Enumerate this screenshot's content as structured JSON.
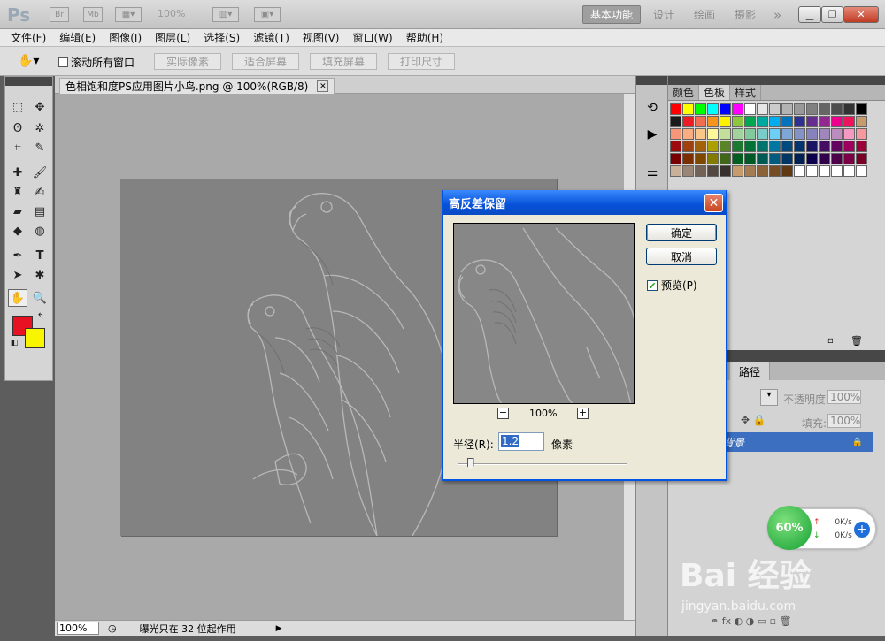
{
  "app": {
    "logo": "Ps",
    "zoom_display": "100%",
    "workspaces": [
      "基本功能",
      "设计",
      "绘画",
      "摄影"
    ],
    "more": "»",
    "bridge_label": "Br",
    "mini_label": "Mb"
  },
  "menu": [
    "文件(F)",
    "编辑(E)",
    "图像(I)",
    "图层(L)",
    "选择(S)",
    "滤镜(T)",
    "视图(V)",
    "窗口(W)",
    "帮助(H)"
  ],
  "options": {
    "scroll_all": "滚动所有窗口",
    "buttons": [
      "实际像素",
      "适合屏幕",
      "填充屏幕",
      "打印尺寸"
    ]
  },
  "document": {
    "tab_title": "色相饱和度PS应用图片小鸟.png @ 100%(RGB/8)",
    "zoom": "100%",
    "status": "曝光只在 32 位起作用"
  },
  "panels": {
    "swatch_tabs": [
      "颜色",
      "色板",
      "样式"
    ],
    "layer_tabs": [
      "路径"
    ],
    "opacity_label": "不透明度:",
    "opacity_value": "100%",
    "fill_label": "填充:",
    "fill_value": "100%",
    "layer_name": "背景",
    "swatch_colors": [
      "#ff0000",
      "#ffff00",
      "#00ff00",
      "#00ffff",
      "#0000ff",
      "#ff00ff",
      "#ffffff",
      "#e6e6e6",
      "#cccccc",
      "#b3b3b3",
      "#999999",
      "#808080",
      "#666666",
      "#4d4d4d",
      "#333333",
      "#000000",
      "#1a1a1a",
      "#ed1c24",
      "#f26c4f",
      "#f7941d",
      "#fff200",
      "#8dc63f",
      "#00a651",
      "#00a99d",
      "#00aeef",
      "#0072bc",
      "#2e3192",
      "#662d91",
      "#92278f",
      "#ec008c",
      "#ed145b",
      "#c69c6d",
      "#f69679",
      "#f9ad81",
      "#fdc689",
      "#fff799",
      "#c4df9b",
      "#a3d39c",
      "#82ca9c",
      "#7accc8",
      "#6dcff6",
      "#7da7d8",
      "#8393ca",
      "#8781bd",
      "#a186be",
      "#bd8cbf",
      "#f49ac2",
      "#f6989d",
      "#9e0b0f",
      "#a0410d",
      "#a36209",
      "#aba000",
      "#598527",
      "#1a7b30",
      "#007236",
      "#00746b",
      "#0076a3",
      "#004a80",
      "#003471",
      "#1b1464",
      "#440e62",
      "#630460",
      "#9e005d",
      "#9e0039",
      "#790000",
      "#7b2e00",
      "#7d4900",
      "#827b00",
      "#406618",
      "#005e20",
      "#005826",
      "#005952",
      "#005b7f",
      "#003663",
      "#002157",
      "#0d004c",
      "#32004b",
      "#4b0049",
      "#7b0046",
      "#7a0026",
      "#c7b299",
      "#998675",
      "#736357",
      "#534741",
      "#37302d",
      "#c69c6d",
      "#a67c52",
      "#8c6239",
      "#754c24",
      "#603913",
      "#ffffff",
      "#ffffff",
      "#ffffff",
      "#ffffff",
      "#ffffff",
      "#ffffff"
    ]
  },
  "dialog": {
    "title": "高反差保留",
    "ok": "确定",
    "cancel": "取消",
    "preview_label": "预览(P)",
    "zoom_out": "−",
    "zoom_in": "+",
    "zoom": "100%",
    "radius_label": "半径(R):",
    "radius_value": "1.2",
    "radius_unit": "像素",
    "slider_level_fraction": 0.05
  },
  "netwidget": {
    "percent": "60%",
    "up": "0K/s",
    "down": "0K/s"
  },
  "watermark": {
    "main": "Bai 经验",
    "sub": "jingyan.baidu.com"
  }
}
